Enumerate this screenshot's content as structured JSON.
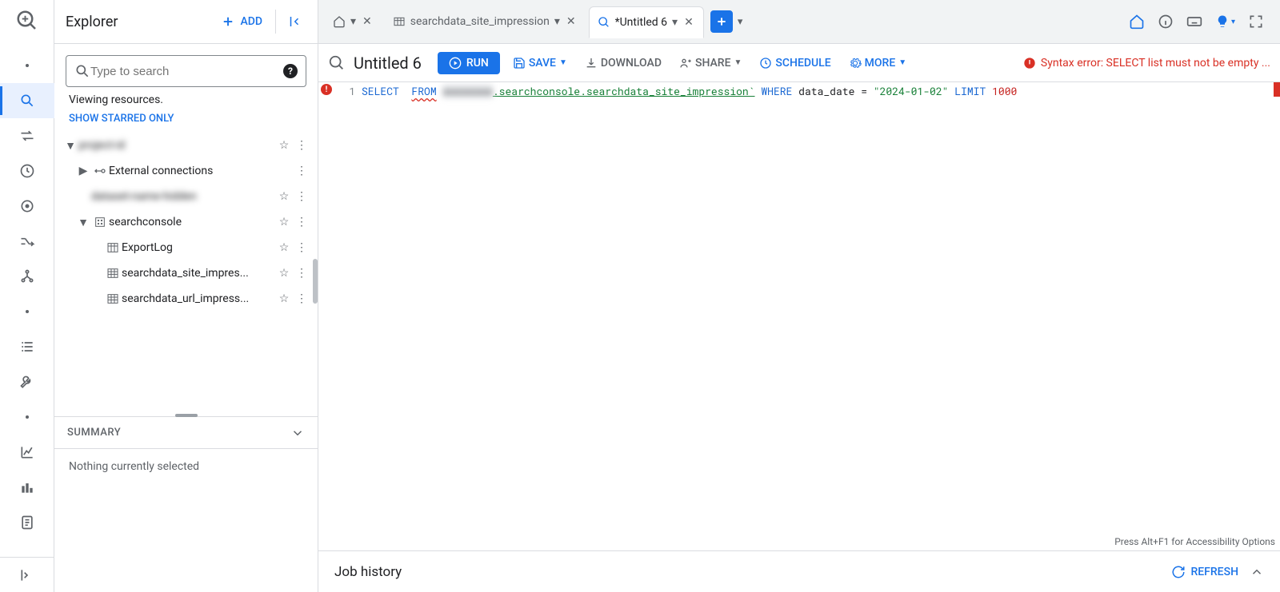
{
  "explorer": {
    "title": "Explorer",
    "add_label": "ADD",
    "search_placeholder": "Type to search",
    "viewing_text": "Viewing resources.",
    "starred_link": "SHOW STARRED ONLY"
  },
  "tree": {
    "project_blurred": "project-id",
    "external_conn": "External connections",
    "dataset_blurred": "dataset-name-hidden",
    "dataset_sc": "searchconsole",
    "table_exportlog": "ExportLog",
    "table_site": "searchdata_site_impres...",
    "table_url": "searchdata_url_impress..."
  },
  "summary": {
    "title": "SUMMARY",
    "empty": "Nothing currently selected"
  },
  "tabs": {
    "t1": "searchdata_site_impression",
    "t2": "*Untitled 6"
  },
  "toolbar": {
    "title": "Untitled 6",
    "run": "RUN",
    "save": "SAVE",
    "download": "DOWNLOAD",
    "share": "SHARE",
    "schedule": "SCHEDULE",
    "more": "MORE",
    "error": "Syntax error: SELECT list must not be empty ..."
  },
  "editor": {
    "line_no": "1",
    "kw_select": "SELECT",
    "kw_from": "FROM",
    "project_blur": "xxxxxxxx",
    "table_path": ".searchconsole.searchdata_site_impression`",
    "kw_where": "WHERE",
    "col": "data_date",
    "eq": "=",
    "date": "\"2024-01-02\"",
    "kw_limit": "LIMIT",
    "limit_n": "1000",
    "a11y": "Press Alt+F1 for Accessibility Options"
  },
  "jobhist": {
    "title": "Job history",
    "refresh": "REFRESH"
  }
}
